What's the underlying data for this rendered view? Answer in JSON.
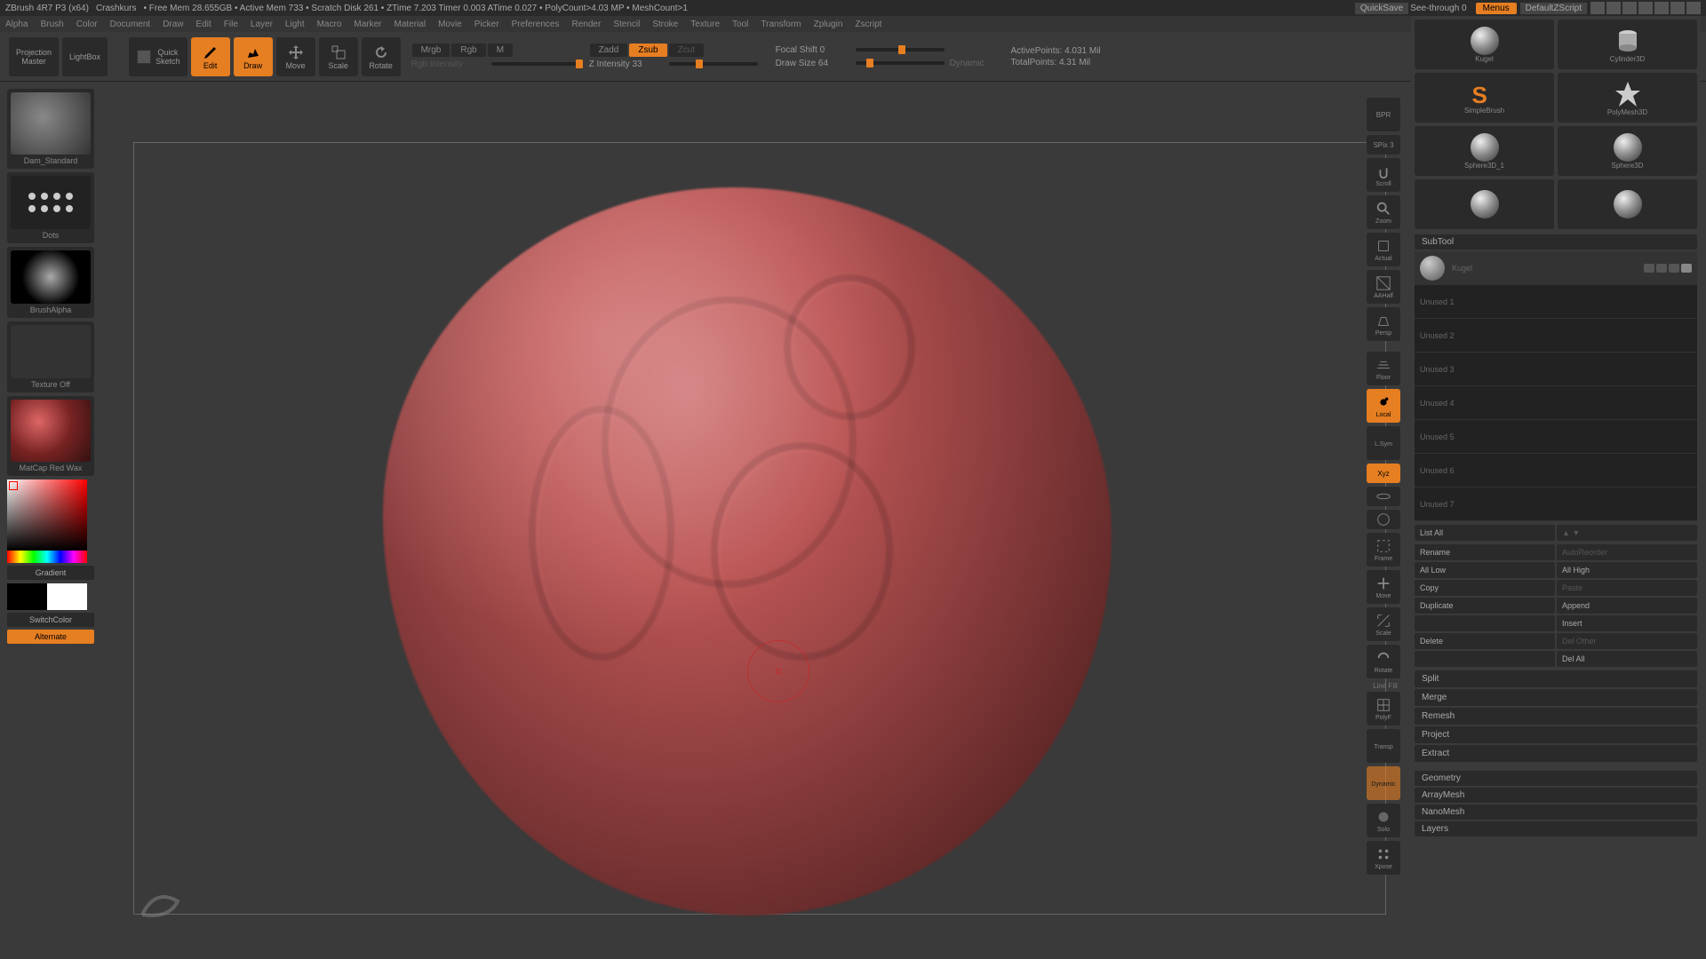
{
  "title_bar": {
    "app": "ZBrush 4R7 P3 (x64)",
    "doc": "Crashkurs",
    "stats": "• Free Mem 28.655GB • Active Mem 733 • Scratch Disk 261 • ZTime 7.203 Timer 0.003 ATime 0.027 • PolyCount>4.03 MP • MeshCount>1",
    "quicksave": "QuickSave",
    "seethrough": "See-through  0",
    "menus": "Menus",
    "script": "DefaultZScript"
  },
  "menu": [
    "Alpha",
    "Brush",
    "Color",
    "Document",
    "Draw",
    "Edit",
    "File",
    "Layer",
    "Light",
    "Macro",
    "Marker",
    "Material",
    "Movie",
    "Picker",
    "Preferences",
    "Render",
    "Stencil",
    "Stroke",
    "Texture",
    "Tool",
    "Transform",
    "Zplugin",
    "Zscript"
  ],
  "shelf": {
    "projection": "Projection\nMaster",
    "lightbox": "LightBox",
    "quicksketch": "Quick\nSketch",
    "edit": "Edit",
    "draw": "Draw",
    "move": "Move",
    "scale": "Scale",
    "rotate": "Rotate",
    "mrgb": "Mrgb",
    "rgb": "Rgb",
    "m": "M",
    "rgb_int": "Rgb Intensity",
    "zadd": "Zadd",
    "zsub": "Zsub",
    "zcut": "Zcut",
    "zint": "Z Intensity 33",
    "focal": "Focal Shift 0",
    "size": "Draw Size 64",
    "dynamic": "Dynamic",
    "active": "ActivePoints: 4.031 Mil",
    "total": "TotalPoints: 4.31 Mil"
  },
  "left": {
    "brush": "Dam_Standard",
    "stroke": "Dots",
    "alpha": "BrushAlpha",
    "texture": "Texture Off",
    "material": "MatCap Red Wax",
    "gradient": "Gradient",
    "switch": "SwitchColor",
    "alternate": "Alternate"
  },
  "dock": {
    "bpr": "BPR",
    "spix": "SPix 3",
    "scroll": "Scroll",
    "zoom": "Zoom",
    "actual": "Actual",
    "aahalf": "AAHalf",
    "persp": "Persp",
    "floor": "Floor",
    "local": "Local",
    "lsym": "L.Sym",
    "xyz": "Xyz",
    "frame": "Frame",
    "move": "Move",
    "scale": "Scale",
    "rotate": "Rotate",
    "polyf": "PolyF",
    "transp": "Transp",
    "solo": "Solo",
    "xpose": "Xpose",
    "dynamic": "Dynamic",
    "linefill": "Line Fill"
  },
  "tools": {
    "kugel": "Kugel",
    "cyl": "Cylinder3D",
    "simple": "SimpleBrush",
    "poly": "PolyMesh3D",
    "sph1": "Sphere3D_1",
    "sph2": "Sphere3D",
    "blank": ""
  },
  "subtool": {
    "header": "SubTool",
    "active": "Kugel",
    "slots": [
      "Unused 1",
      "Unused 2",
      "Unused 3",
      "Unused 4",
      "Unused 5",
      "Unused 6",
      "Unused 7"
    ],
    "listall": "List All",
    "rename": "Rename",
    "autoreorder": "AutoReorder",
    "alllow": "All Low",
    "allhigh": "All High",
    "copy": "Copy",
    "paste": "Paste",
    "duplicate": "Duplicate",
    "append": "Append",
    "insert": "Insert",
    "delete": "Delete",
    "delother": "Del Other",
    "delall": "Del All",
    "split": "Split",
    "merge": "Merge",
    "remesh": "Remesh",
    "project": "Project",
    "extract": "Extract"
  },
  "sections": [
    "Geometry",
    "ArrayMesh",
    "NanoMesh",
    "Layers"
  ]
}
